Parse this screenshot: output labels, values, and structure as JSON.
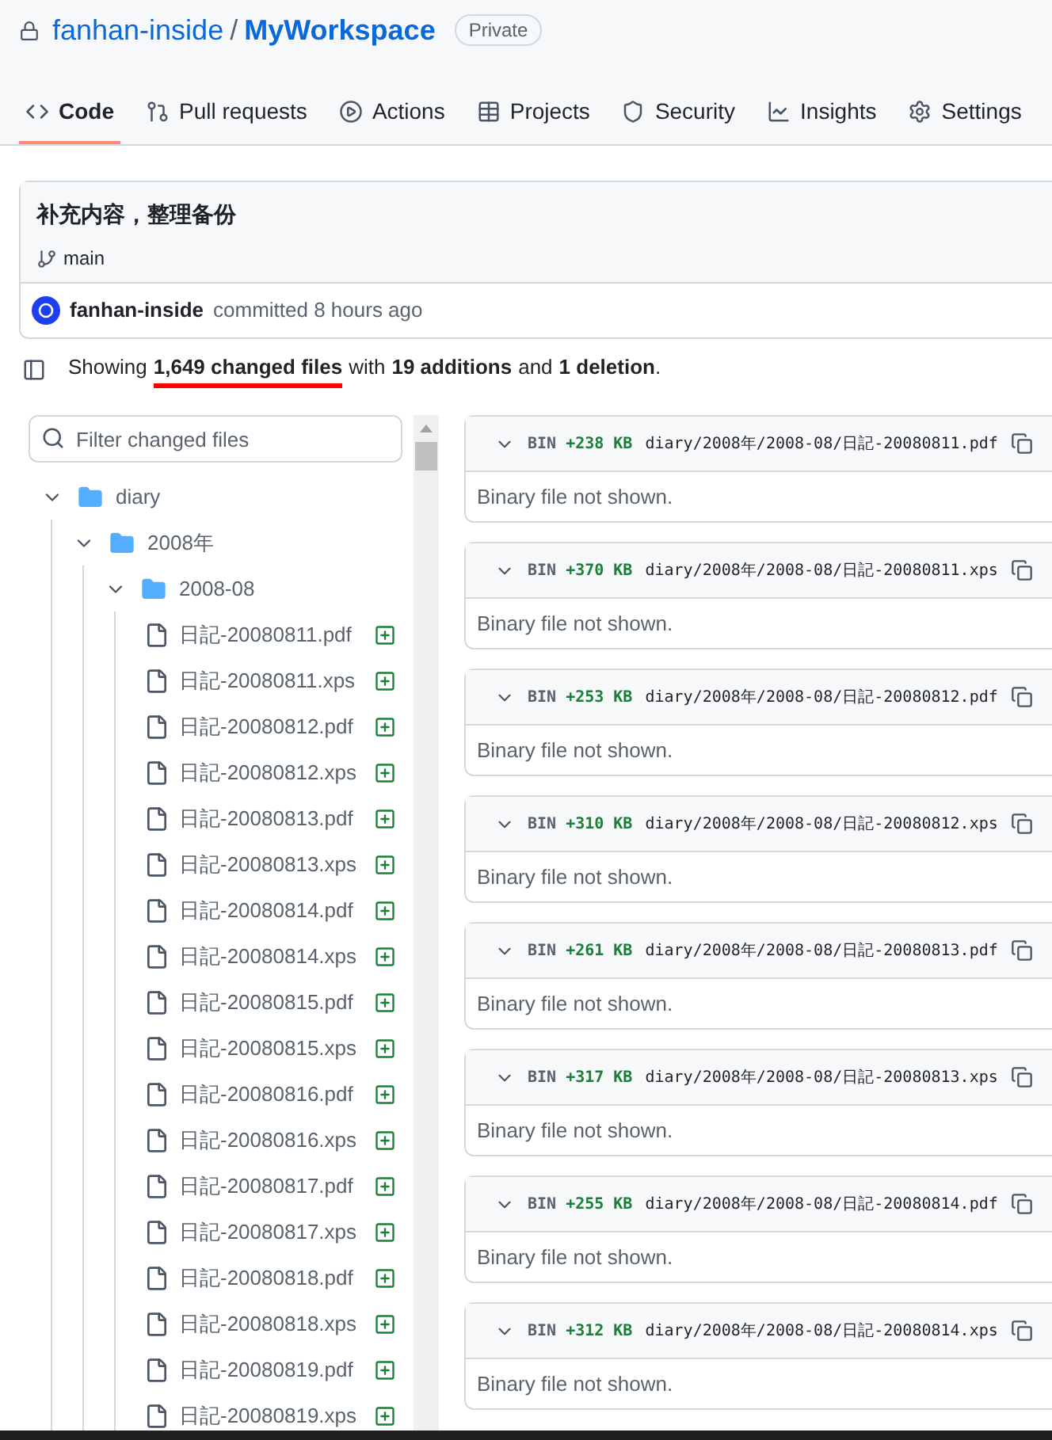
{
  "repo": {
    "owner": "fanhan-inside",
    "separator": "/",
    "name": "MyWorkspace",
    "visibility": "Private"
  },
  "tabs": [
    {
      "label": "Code",
      "selected": true
    },
    {
      "label": "Pull requests",
      "selected": false
    },
    {
      "label": "Actions",
      "selected": false
    },
    {
      "label": "Projects",
      "selected": false
    },
    {
      "label": "Security",
      "selected": false
    },
    {
      "label": "Insights",
      "selected": false
    },
    {
      "label": "Settings",
      "selected": false
    }
  ],
  "commit": {
    "message": "补充内容，整理备份",
    "branch": "main",
    "author": "fanhan-inside",
    "action": "committed 8 hours ago"
  },
  "summary": {
    "prefix": "Showing",
    "files": "1,649 changed files",
    "mid1": "with",
    "additions": "19 additions",
    "mid2": "and",
    "deletions": "1 deletion",
    "end": "."
  },
  "filter": {
    "placeholder": "Filter changed files"
  },
  "tree": [
    {
      "name": "diary",
      "expanded": true,
      "children": [
        {
          "name": "2008年",
          "expanded": true,
          "children": [
            {
              "name": "2008-08",
              "expanded": true,
              "children": [
                {
                  "name": "日記-20080811.pdf"
                },
                {
                  "name": "日記-20080811.xps"
                },
                {
                  "name": "日記-20080812.pdf"
                },
                {
                  "name": "日記-20080812.xps"
                },
                {
                  "name": "日記-20080813.pdf"
                },
                {
                  "name": "日記-20080813.xps"
                },
                {
                  "name": "日記-20080814.pdf"
                },
                {
                  "name": "日記-20080814.xps"
                },
                {
                  "name": "日記-20080815.pdf"
                },
                {
                  "name": "日記-20080815.xps"
                },
                {
                  "name": "日記-20080816.pdf"
                },
                {
                  "name": "日記-20080816.xps"
                },
                {
                  "name": "日記-20080817.pdf"
                },
                {
                  "name": "日記-20080817.xps"
                },
                {
                  "name": "日記-20080818.pdf"
                },
                {
                  "name": "日記-20080818.xps"
                },
                {
                  "name": "日記-20080819.pdf"
                },
                {
                  "name": "日記-20080819.xps"
                }
              ]
            }
          ]
        }
      ]
    }
  ],
  "diffs": [
    {
      "type": "BIN",
      "size": "+238 KB",
      "path": "diary/2008年/2008-08/日記-20080811.pdf",
      "body": "Binary file not shown."
    },
    {
      "type": "BIN",
      "size": "+370 KB",
      "path": "diary/2008年/2008-08/日記-20080811.xps",
      "body": "Binary file not shown."
    },
    {
      "type": "BIN",
      "size": "+253 KB",
      "path": "diary/2008年/2008-08/日記-20080812.pdf",
      "body": "Binary file not shown."
    },
    {
      "type": "BIN",
      "size": "+310 KB",
      "path": "diary/2008年/2008-08/日記-20080812.xps",
      "body": "Binary file not shown."
    },
    {
      "type": "BIN",
      "size": "+261 KB",
      "path": "diary/2008年/2008-08/日記-20080813.pdf",
      "body": "Binary file not shown."
    },
    {
      "type": "BIN",
      "size": "+317 KB",
      "path": "diary/2008年/2008-08/日記-20080813.xps",
      "body": "Binary file not shown."
    },
    {
      "type": "BIN",
      "size": "+255 KB",
      "path": "diary/2008年/2008-08/日記-20080814.pdf",
      "body": "Binary file not shown."
    },
    {
      "type": "BIN",
      "size": "+312 KB",
      "path": "diary/2008年/2008-08/日記-20080814.xps",
      "body": "Binary file not shown."
    }
  ]
}
